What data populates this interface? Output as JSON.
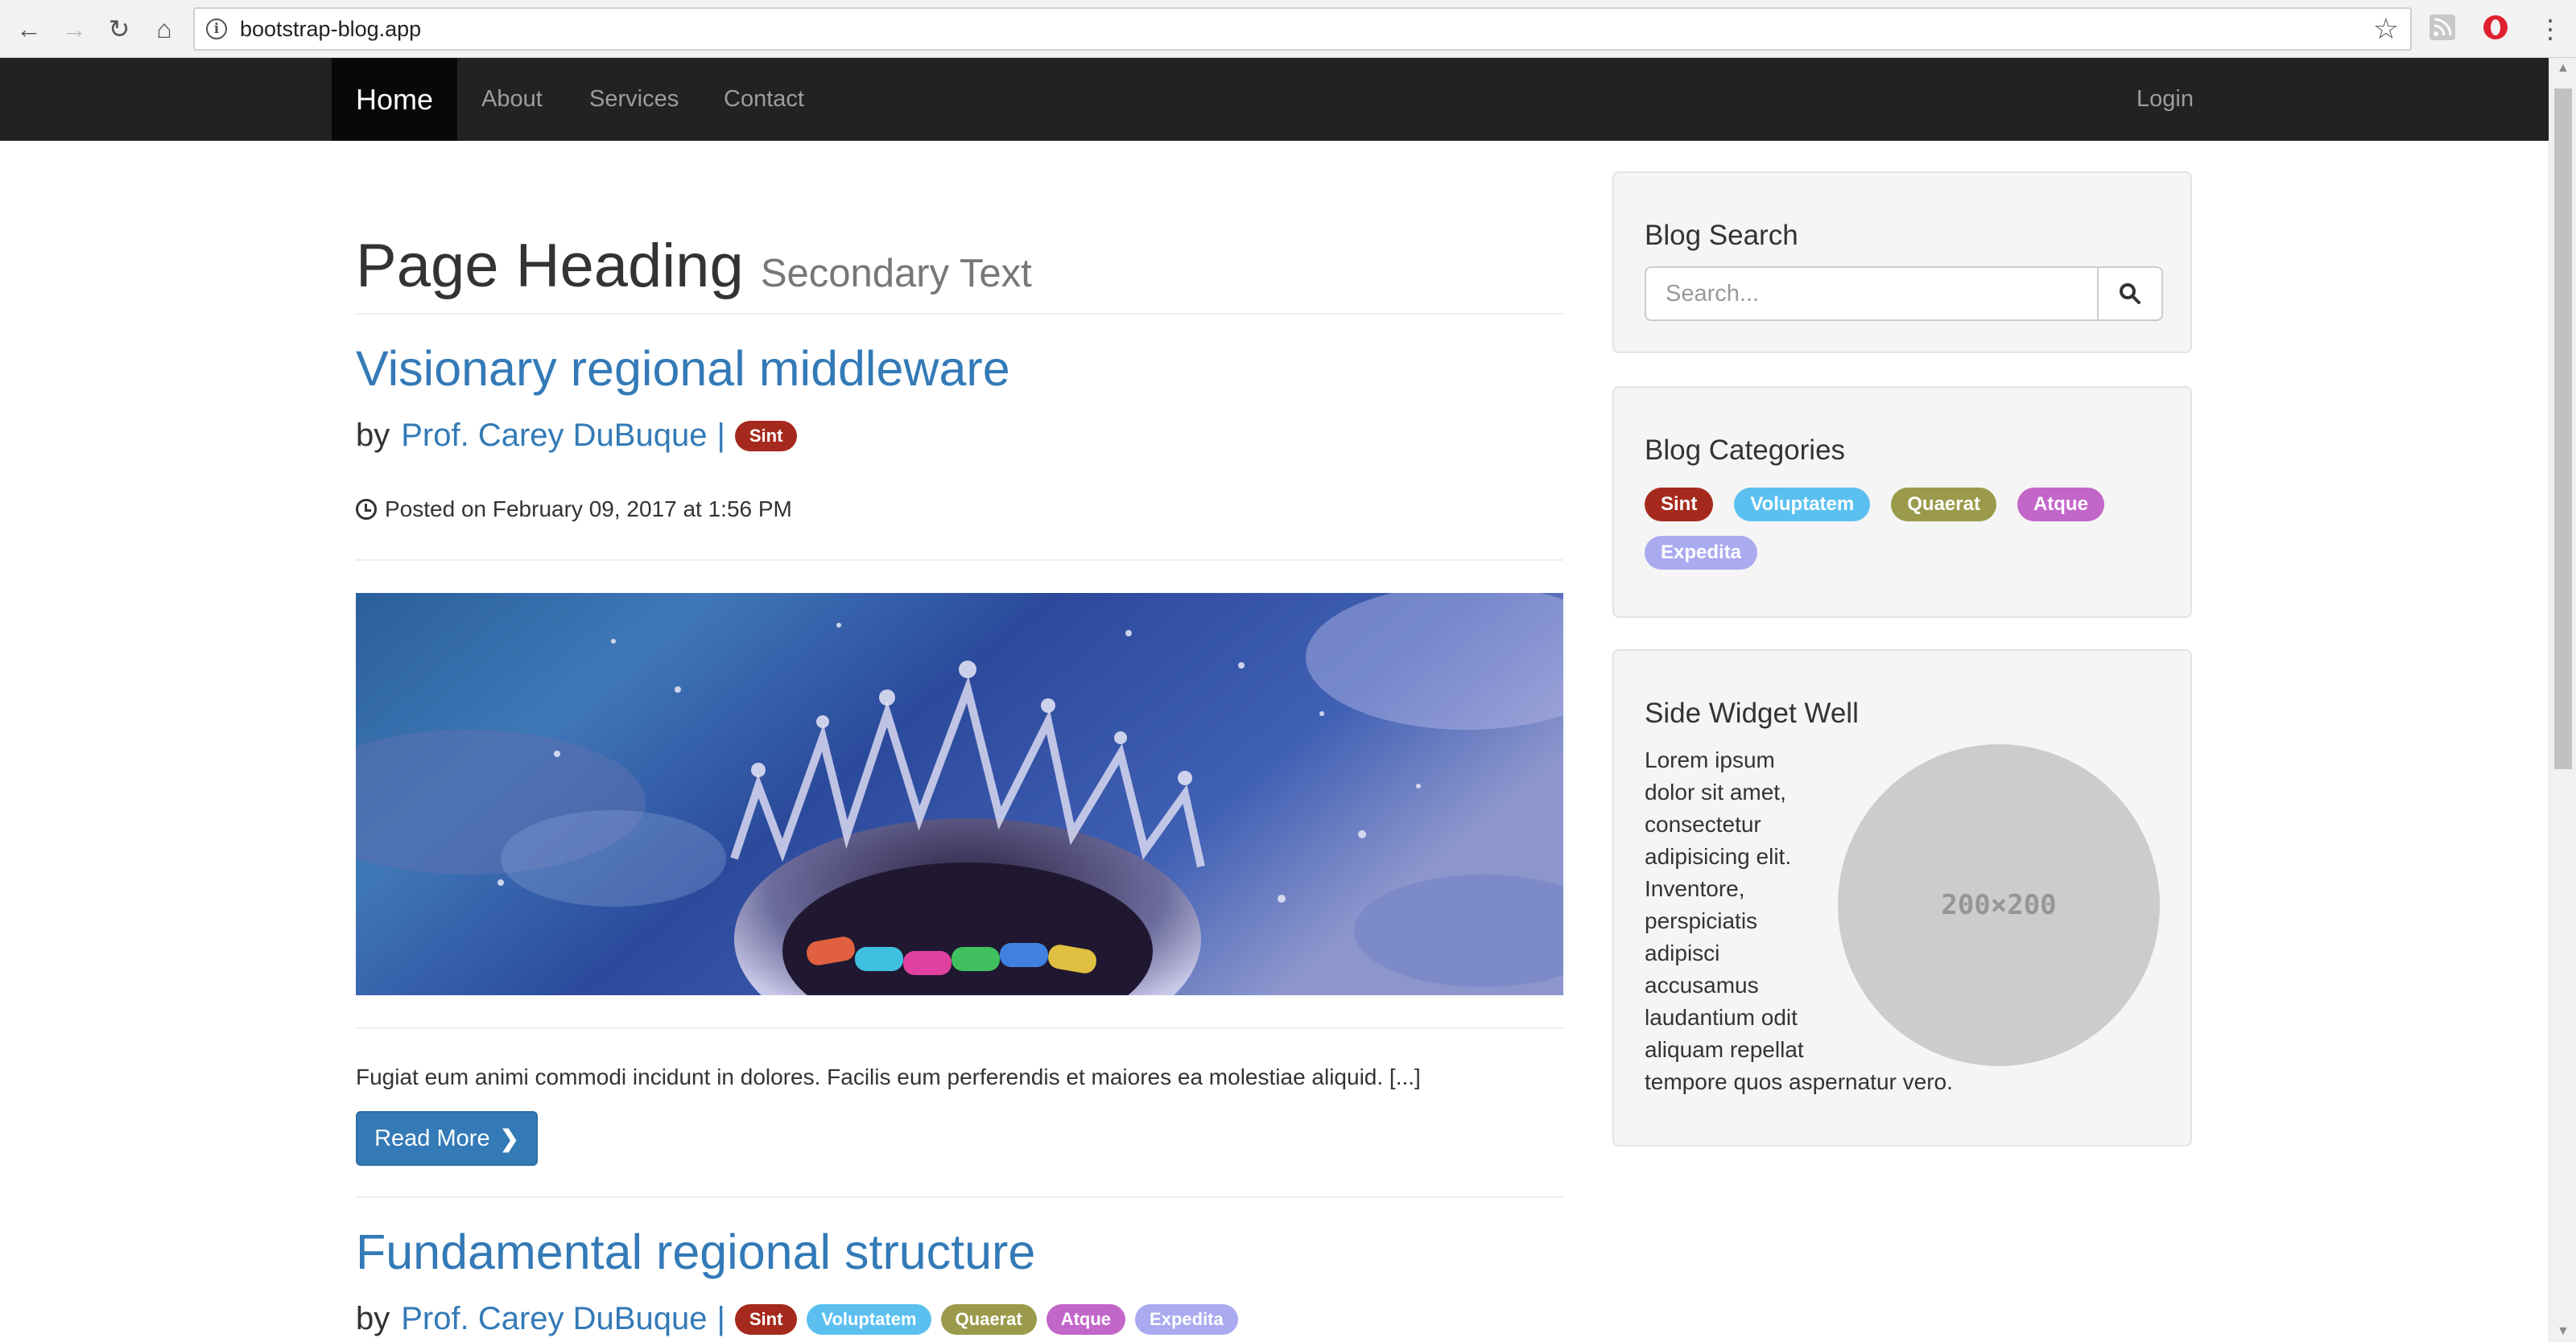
{
  "browser": {
    "url": "bootstrap-blog.app",
    "back_icon": "←",
    "forward_icon": "→",
    "reload_icon": "↻",
    "home_icon": "⌂",
    "info_icon": "i",
    "star_icon": "☆",
    "menu_icon": "⋮"
  },
  "navbar": {
    "home": "Home",
    "about": "About",
    "services": "Services",
    "contact": "Contact",
    "login": "Login"
  },
  "page": {
    "heading": "Page Heading",
    "secondary": "Secondary Text"
  },
  "posts": [
    {
      "title": "Visionary regional middleware",
      "by": "by",
      "author": "Prof. Carey DuBuque",
      "separator": "|",
      "tags": [
        "Sint"
      ],
      "posted": "Posted on February 09, 2017 at 1:56 PM",
      "excerpt": "Fugiat eum animi commodi incidunt in dolores. Facilis eum perferendis et maiores ea molestiae aliquid. [...]",
      "read_more": "Read More"
    },
    {
      "title": "Fundamental regional structure",
      "by": "by",
      "author": "Prof. Carey DuBuque",
      "separator": "|",
      "tags": [
        "Sint",
        "Voluptatem",
        "Quaerat",
        "Atque",
        "Expedita"
      ]
    }
  ],
  "sidebar": {
    "search": {
      "title": "Blog Search",
      "placeholder": "Search..."
    },
    "categories": {
      "title": "Blog Categories",
      "items": [
        "Sint",
        "Voluptatem",
        "Quaerat",
        "Atque",
        "Expedita"
      ]
    },
    "widget": {
      "title": "Side Widget Well",
      "text": "Lorem ipsum dolor sit amet, consectetur adipisicing elit. Inventore, perspiciatis adipisci accusamus laudantium odit aliquam repellat tempore quos aspernatur vero.",
      "placeholder_image": "200×200"
    }
  },
  "colors": {
    "link": "#337ab7",
    "navbar": "#222222",
    "tag_sint": "#a52a1d",
    "tag_voluptatem": "#5bc0f0",
    "tag_quaerat": "#9a9a4a",
    "tag_atque": "#c266c9",
    "tag_expedita": "#aaaaf0"
  }
}
